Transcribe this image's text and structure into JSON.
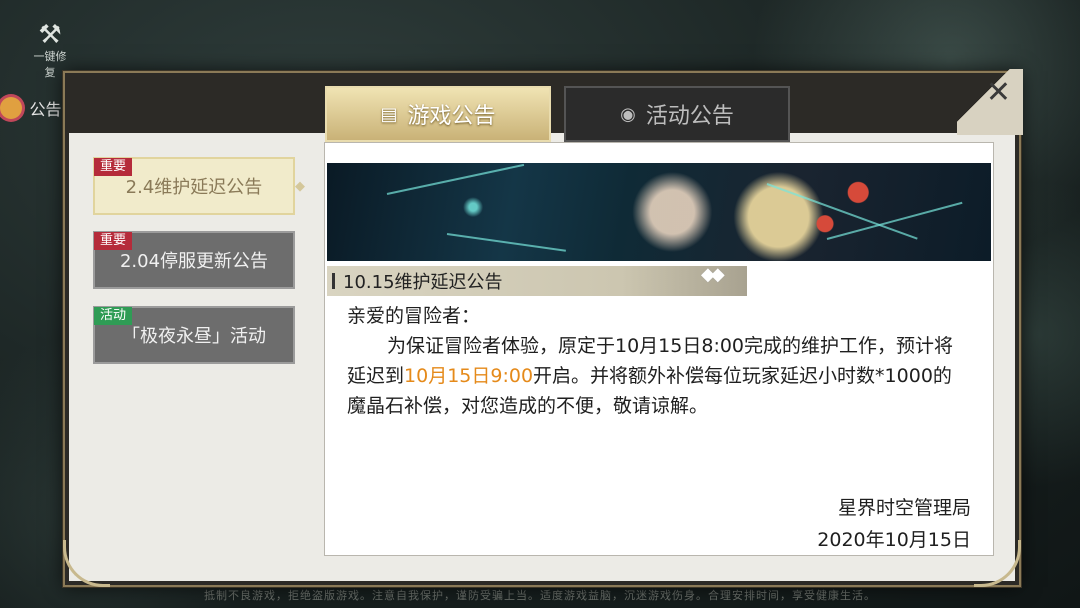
{
  "background": {
    "repair_label": "一键修复",
    "notice_label": "公告",
    "footer": "抵制不良游戏，拒绝盗版游戏。注意自我保护，谨防受骗上当。适度游戏益脑，沉迷游戏伤身。合理安排时间，享受健康生活。"
  },
  "tabs": [
    {
      "label": "游戏公告",
      "icon": "notice-board-icon",
      "active": true
    },
    {
      "label": "活动公告",
      "icon": "activity-icon",
      "active": false
    }
  ],
  "close_glyph": "✕",
  "sidebar": {
    "items": [
      {
        "tag": "重要",
        "tag_color": "#b52b3a",
        "label": "2.4维护延迟公告",
        "active": true
      },
      {
        "tag": "重要",
        "tag_color": "#b52b3a",
        "label": "2.04停服更新公告",
        "active": false
      },
      {
        "tag": "活动",
        "tag_color": "#2f9c55",
        "label": "「极夜永昼」活动",
        "active": false
      }
    ]
  },
  "content": {
    "title": "10.15维护延迟公告",
    "greeting": "亲爱的冒险者：",
    "para_before": "为保证冒险者体验，原定于10月15日8:00完成的维护工作，预计将延迟到",
    "highlight": "10月15日9:00",
    "para_after": "开启。并将额外补偿每位玩家延迟小时数*1000的魔晶石补偿，对您造成的不便，敬请谅解。",
    "signature": "星界时空管理局",
    "date": "2020年10月15日",
    "highlight_color": "#e58a1a"
  }
}
